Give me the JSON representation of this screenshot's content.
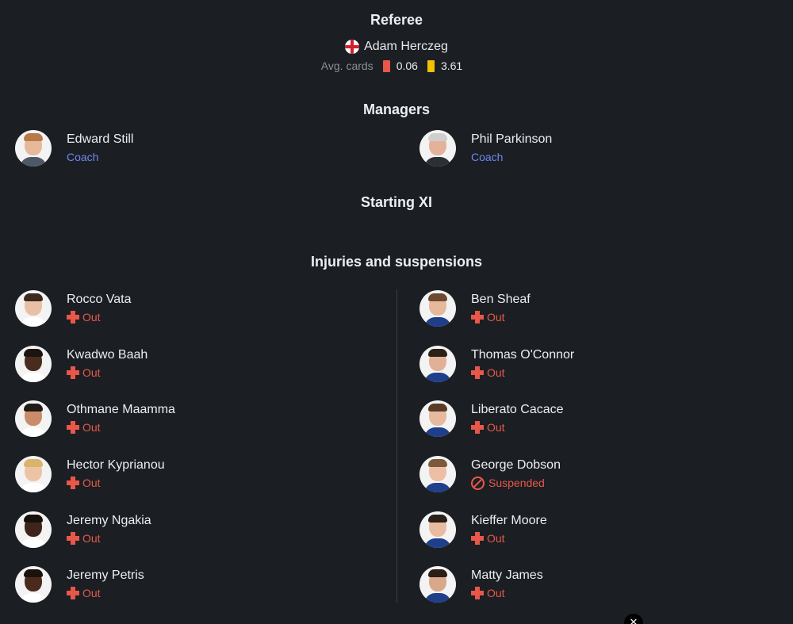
{
  "referee": {
    "title": "Referee",
    "name": "Adam Herczeg",
    "flag": "england-flag-icon",
    "avg_label": "Avg. cards",
    "red_cards": "0.06",
    "yellow_cards": "3.61",
    "red_color": "#e8574a",
    "yellow_color": "#f2c200"
  },
  "managers": {
    "title": "Managers",
    "home": {
      "name": "Edward Still",
      "role": "Coach"
    },
    "away": {
      "name": "Phil Parkinson",
      "role": "Coach"
    }
  },
  "starting_xi": {
    "title": "Starting XI"
  },
  "injuries": {
    "title": "Injuries and suspensions",
    "home": [
      {
        "name": "Rocco Vata",
        "status": "Out",
        "icon": "injury-cross-icon"
      },
      {
        "name": "Kwadwo Baah",
        "status": "Out",
        "icon": "injury-cross-icon"
      },
      {
        "name": "Othmane Maamma",
        "status": "Out",
        "icon": "injury-cross-icon"
      },
      {
        "name": "Hector Kyprianou",
        "status": "Out",
        "icon": "injury-cross-icon"
      },
      {
        "name": "Jeremy Ngakia",
        "status": "Out",
        "icon": "injury-cross-icon"
      },
      {
        "name": "Jeremy Petris",
        "status": "Out",
        "icon": "injury-cross-icon"
      }
    ],
    "away": [
      {
        "name": "Ben Sheaf",
        "status": "Out",
        "icon": "injury-cross-icon"
      },
      {
        "name": "Thomas O'Connor",
        "status": "Out",
        "icon": "injury-cross-icon"
      },
      {
        "name": "Liberato Cacace",
        "status": "Out",
        "icon": "injury-cross-icon"
      },
      {
        "name": "George Dobson",
        "status": "Suspended",
        "icon": "suspended-icon"
      },
      {
        "name": "Kieffer Moore",
        "status": "Out",
        "icon": "injury-cross-icon"
      },
      {
        "name": "Matty James",
        "status": "Out",
        "icon": "injury-cross-icon"
      }
    ]
  },
  "colors": {
    "background": "#1b1f23",
    "accent_coach": "#6f86f5",
    "status_red": "#e8574a"
  },
  "close_button": {
    "icon": "close-icon",
    "glyph": "✕"
  }
}
